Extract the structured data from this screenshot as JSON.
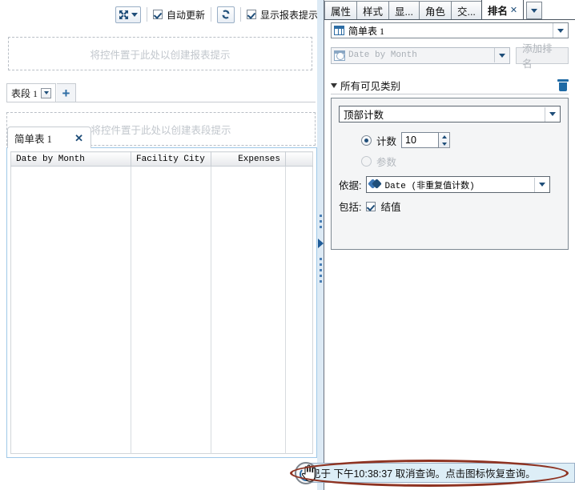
{
  "toolbar": {
    "expand_icon": "expand-arrows-icon",
    "expand_dropdown_icon": "chevron-down-icon",
    "auto_refresh_label": "自动更新",
    "auto_refresh_checked": true,
    "refresh_icon": "refresh-icon",
    "show_hints_label": "显示报表提示",
    "show_hints_checked": true
  },
  "left": {
    "prompt_dropzone_text": "将控件置于此处以创建报表提示",
    "section_dropzone_text": "将控件置于此处以创建表段提示",
    "section_tab_label": "表段 1",
    "section_tab_dropdown_icon": "chevron-down-icon",
    "add_section_label": "+",
    "table_tab_label": "简单表 1",
    "table_tab_close_icon": "close-icon",
    "table": {
      "columns": [
        {
          "label": "Date by Month",
          "align": "left"
        },
        {
          "label": "Facility City",
          "align": "left"
        },
        {
          "label": "Expenses",
          "align": "right"
        },
        {
          "label": "",
          "align": "left"
        }
      ],
      "rows": []
    },
    "splitter": {
      "collapse_icon": "triangle-right-icon",
      "grip_icon": "drag-grip-icon"
    }
  },
  "right": {
    "tabs": [
      {
        "label": "属性",
        "active": false,
        "closable": false
      },
      {
        "label": "样式",
        "active": false,
        "closable": false
      },
      {
        "label": "显...",
        "active": false,
        "closable": false
      },
      {
        "label": "角色",
        "active": false,
        "closable": false
      },
      {
        "label": "交...",
        "active": false,
        "closable": false
      },
      {
        "label": "排名",
        "active": true,
        "closable": true
      }
    ],
    "tabs_overflow_icon": "chevron-down-icon",
    "object_chooser": {
      "icon": "table-grid-icon",
      "value": "简单表 1",
      "dropdown_icon": "chevron-down-icon"
    },
    "field_row": {
      "icon": "date-time-icon",
      "value": "Date by Month",
      "dropdown_icon": "chevron-down-icon",
      "add_rank_label": "添加排名",
      "add_rank_disabled": true
    },
    "group": {
      "expander_icon": "triangle-down-icon",
      "title": "所有可见类别",
      "delete_icon": "trash-icon"
    },
    "rank_type": {
      "value": "顶部计数",
      "dropdown_icon": "chevron-down-icon"
    },
    "count_option": {
      "label": "计数",
      "selected": true,
      "value": "10",
      "stepper_up_icon": "spin-up-icon",
      "stepper_down_icon": "spin-down-icon"
    },
    "param_option": {
      "label": "参数",
      "selected": false,
      "disabled": true
    },
    "basis": {
      "label": "依据:",
      "icon": "measure-tags-icon",
      "value": "Date (非重复值计数)",
      "dropdown_icon": "chevron-down-icon"
    },
    "include": {
      "label": "包括:",
      "checkbox_label": "结值",
      "checked": true
    }
  },
  "status": {
    "text": "已于 下午10:38:37 取消查询。点击图标恢复查询。",
    "icon": "cancelled-query-icon",
    "cursor_icon": "hand-pointer-cursor",
    "highlight_color": "#8e3322",
    "background_color": "#ddeef7"
  }
}
